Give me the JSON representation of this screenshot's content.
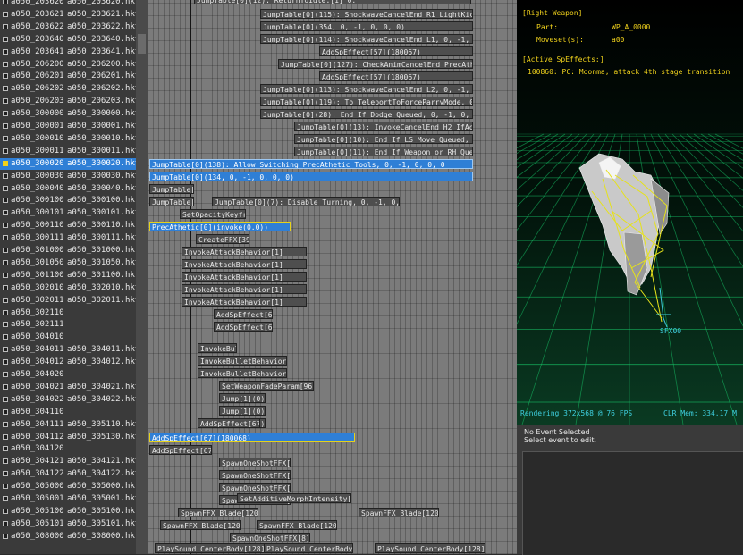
{
  "anim_list": [
    {
      "id": "a050_203620",
      "file": "a050_203620.hkt",
      "sel": false
    },
    {
      "id": "a050_203621",
      "file": "a050_203621.hkt",
      "sel": false
    },
    {
      "id": "a050_203622",
      "file": "a050_203622.hkt",
      "sel": false
    },
    {
      "id": "a050_203640",
      "file": "a050_203640.hkt",
      "sel": false
    },
    {
      "id": "a050_203641",
      "file": "a050_203641.hkt",
      "sel": false
    },
    {
      "id": "a050_206200",
      "file": "a050_206200.hkt",
      "sel": false
    },
    {
      "id": "a050_206201",
      "file": "a050_206201.hkt",
      "sel": false
    },
    {
      "id": "a050_206202",
      "file": "a050_206202.hkt",
      "sel": false
    },
    {
      "id": "a050_206203",
      "file": "a050_206203.hkt",
      "sel": false
    },
    {
      "id": "a050_300000",
      "file": "a050_300000.hkt",
      "sel": false
    },
    {
      "id": "a050_300001",
      "file": "a050_300001.hkt",
      "sel": false
    },
    {
      "id": "a050_300010",
      "file": "a050_300010.hkt",
      "sel": false
    },
    {
      "id": "a050_300011",
      "file": "a050_300011.hkt",
      "sel": false
    },
    {
      "id": "a050_300020",
      "file": "a050_300020.hkt",
      "sel": true
    },
    {
      "id": "a050_300030",
      "file": "a050_300030.hkt",
      "sel": false
    },
    {
      "id": "a050_300040",
      "file": "a050_300040.hkt",
      "sel": false
    },
    {
      "id": "a050_300100",
      "file": "a050_300100.hkt",
      "sel": false
    },
    {
      "id": "a050_300101",
      "file": "a050_300101.hkt",
      "sel": false
    },
    {
      "id": "a050_300110",
      "file": "a050_300110.hkt",
      "sel": false
    },
    {
      "id": "a050_300111",
      "file": "a050_300111.hkt",
      "sel": false
    },
    {
      "id": "a050_301000",
      "file": "a050_301000.hkt",
      "sel": false
    },
    {
      "id": "a050_301050",
      "file": "a050_301050.hkt",
      "sel": false
    },
    {
      "id": "a050_301100",
      "file": "a050_301100.hkt",
      "sel": false
    },
    {
      "id": "a050_302010",
      "file": "a050_302010.hkt",
      "sel": false
    },
    {
      "id": "a050_302011",
      "file": "a050_302011.hkt",
      "sel": false
    },
    {
      "id": "a050_302110",
      "file": "",
      "sel": false
    },
    {
      "id": "a050_302111",
      "file": "",
      "sel": false
    },
    {
      "id": "a050_304010",
      "file": "",
      "sel": false
    },
    {
      "id": "a050_304011",
      "file": "a050_304011.hkt",
      "sel": false
    },
    {
      "id": "a050_304012",
      "file": "a050_304012.hkt",
      "sel": false
    },
    {
      "id": "a050_304020",
      "file": "",
      "sel": false
    },
    {
      "id": "a050_304021",
      "file": "a050_304021.hkt",
      "sel": false
    },
    {
      "id": "a050_304022",
      "file": "a050_304022.hkt",
      "sel": false
    },
    {
      "id": "a050_304110",
      "file": "",
      "sel": false
    },
    {
      "id": "a050_304111",
      "file": "a050_305110.hkt",
      "sel": false
    },
    {
      "id": "a050_304112",
      "file": "a050_305130.hkt",
      "sel": false
    },
    {
      "id": "a050_304120",
      "file": "",
      "sel": false
    },
    {
      "id": "a050_304121",
      "file": "a050_304121.hkt",
      "sel": false
    },
    {
      "id": "a050_304122",
      "file": "a050_304122.hkt",
      "sel": false
    },
    {
      "id": "a050_305000",
      "file": "a050_305000.hkt",
      "sel": false
    },
    {
      "id": "a050_305001",
      "file": "a050_305001.hkt",
      "sel": false
    },
    {
      "id": "a050_305100",
      "file": "a050_305100.hkt",
      "sel": false
    },
    {
      "id": "a050_305101",
      "file": "a050_305101.hkt",
      "sel": false
    },
    {
      "id": "a050_308000",
      "file": "a050_308000.hkt",
      "sel": false
    }
  ],
  "timeline_events": [
    {
      "label": "JumpTable[0](12): ReturnToIdle:[1] 0.",
      "hl": false,
      "y": false
    },
    {
      "label": "JumpTable[0](115): ShockwaveCancelEnd_R1_LightKick, 0, -1, 0, 0",
      "hl": false,
      "y": false
    },
    {
      "label": "JumpTable[0](354, 0, -1, 0, 0, 0)",
      "hl": false,
      "y": false
    },
    {
      "label": "JumpTable[0](114): ShockwaveCancelEnd_L1, 0, -1, 0, 0, 0",
      "hl": false,
      "y": false
    },
    {
      "label": "AddSpEffect[57](180067)",
      "hl": false,
      "y": false
    },
    {
      "label": "JumpTable[0](127): CheckAnimCancelEnd_PrecAthetic, 0",
      "hl": false,
      "y": false
    },
    {
      "label": "AddSpEffect[57](180067)",
      "hl": false,
      "y": false
    },
    {
      "label": "JumpTable[0](113): ShockwaveCancelEnd_L2, 0, -1, 0, 0",
      "hl": false,
      "y": false
    },
    {
      "label": "JumpTable[0](119): To_TeleportToForceParryMode, 0, -1, 0",
      "hl": false,
      "y": false
    },
    {
      "label": "JumpTable[0](28): End If Dodge Queued, 0, -1, 0, 0, 0",
      "hl": false,
      "y": false
    },
    {
      "label": "JumpTable[0](13): InvokeCancelEnd_H2_IfAction, 0",
      "hl": false,
      "y": false
    },
    {
      "label": "JumpTable[0](10): End If LS Move Queued, 0, -1",
      "hl": false,
      "y": false
    },
    {
      "label": "JumpTable[0](11): End If Weapon or RH Queued, 0",
      "hl": false,
      "y": false
    },
    {
      "label": "JumpTable[0](138): Allow Switching PrecAthetic Tools, 0, -1, 0, 0, 0",
      "hl": true,
      "y": false
    },
    {
      "label": "JumpTable[0](134, 0, -1, 0, 0, 0)",
      "hl": true,
      "y": false
    },
    {
      "label": "JumpTable[0]",
      "hl": false,
      "y": false
    },
    {
      "label": "JumpTable[0]",
      "hl": false,
      "y": false
    },
    {
      "label": "JumpTable[0](7): Disable Turning, 0, -1, 0, 0, 0",
      "hl": false,
      "y": false
    },
    {
      "label": "SetOpacityKeyframe[123]",
      "hl": false,
      "y": false
    },
    {
      "label": "PrecAthetic[0](invoke(0.0))",
      "hl": true,
      "y": true
    },
    {
      "label": "CreateFFX[396]",
      "hl": false,
      "y": false
    },
    {
      "label": "InvokeAttackBehavior[1]",
      "hl": false,
      "y": false
    },
    {
      "label": "InvokeAttackBehavior[1]",
      "hl": false,
      "y": false
    },
    {
      "label": "InvokeAttackBehavior[1]",
      "hl": false,
      "y": false
    },
    {
      "label": "InvokeAttackBehavior[1]",
      "hl": false,
      "y": false
    },
    {
      "label": "InvokeAttackBehavior[1]",
      "hl": false,
      "y": false
    },
    {
      "label": "AddSpEffect[67]",
      "hl": false,
      "y": false
    },
    {
      "label": "AddSpEffect[67]",
      "hl": false,
      "y": false
    },
    {
      "label": "InvokeBulletBehavior[1]",
      "hl": false,
      "y": false
    },
    {
      "label": "InvokeBulletBehavior[1]",
      "hl": false,
      "y": false
    },
    {
      "label": "InvokeBulletBehavior[1]",
      "hl": false,
      "y": false
    },
    {
      "label": "SetWeaponFadeParam[96]",
      "hl": false,
      "y": false
    },
    {
      "label": "Jump[1](0)",
      "hl": false,
      "y": false
    },
    {
      "label": "Jump[1](0)",
      "hl": false,
      "y": false
    },
    {
      "label": "Jump[1](0)",
      "hl": false,
      "y": false
    },
    {
      "label": "AddSpEffect[67]",
      "hl": false,
      "y": false
    },
    {
      "label": "AddSpEffect[67](180068)",
      "hl": true,
      "y": true
    },
    {
      "label": "AddSpEffect[67]",
      "hl": false,
      "y": false
    },
    {
      "label": "SpawnOneShotFFX[8]",
      "hl": false,
      "y": false
    },
    {
      "label": "SpawnOneShotFFX[8]",
      "hl": false,
      "y": false
    },
    {
      "label": "SpawnOneShotFFX[8]",
      "hl": false,
      "y": false
    },
    {
      "label": "SpawnOneShotFFX[8]",
      "hl": false,
      "y": false
    },
    {
      "label": "SetAdditiveMorphIntensity[242]",
      "hl": false,
      "y": false
    },
    {
      "label": "SpawnFFX_Blade[120]",
      "hl": false,
      "y": false
    },
    {
      "label": "SpawnFFX_Blade[120]",
      "hl": false,
      "y": false
    },
    {
      "label": "SpawnFFX_Blade[120]",
      "hl": false,
      "y": false
    },
    {
      "label": "SpawnFFX_Blade[120]",
      "hl": false,
      "y": false
    },
    {
      "label": "SpawnOneShotFFX[8]",
      "hl": false,
      "y": false
    },
    {
      "label": "PlaySound_CenterBody[128]",
      "hl": false,
      "y": false
    },
    {
      "label": "PlaySound_CenterBody[128]",
      "hl": false,
      "y": false
    },
    {
      "label": "PlaySound_CenterBody[128]",
      "hl": false,
      "y": false
    }
  ],
  "viewport": {
    "right_weapon_title": "[Right Weapon]",
    "part_label": "Part:",
    "part_value": "WP_A_0000",
    "moveset_label": "Moveset(s):",
    "moveset_value": "a00",
    "active_sp_title": "[Active SpEffects:]",
    "active_sp_line": "100860: PC: Moonma, attack 4th stage transition",
    "sfx_label": "SFX00",
    "render_status": "Rendering 372x568 @ 76 FPS",
    "clr_mem": "CLR Mem:  334.17 M"
  },
  "inspector": {
    "no_event": "No Event Selected",
    "select_hint": "Select event to edit."
  },
  "colors": {
    "selection": "#2f7fd6",
    "selected_marker": "#f3d21a",
    "overlay_text": "#f0d21c",
    "sfx_text": "#3fd0e0",
    "grid": "#18c86a"
  }
}
